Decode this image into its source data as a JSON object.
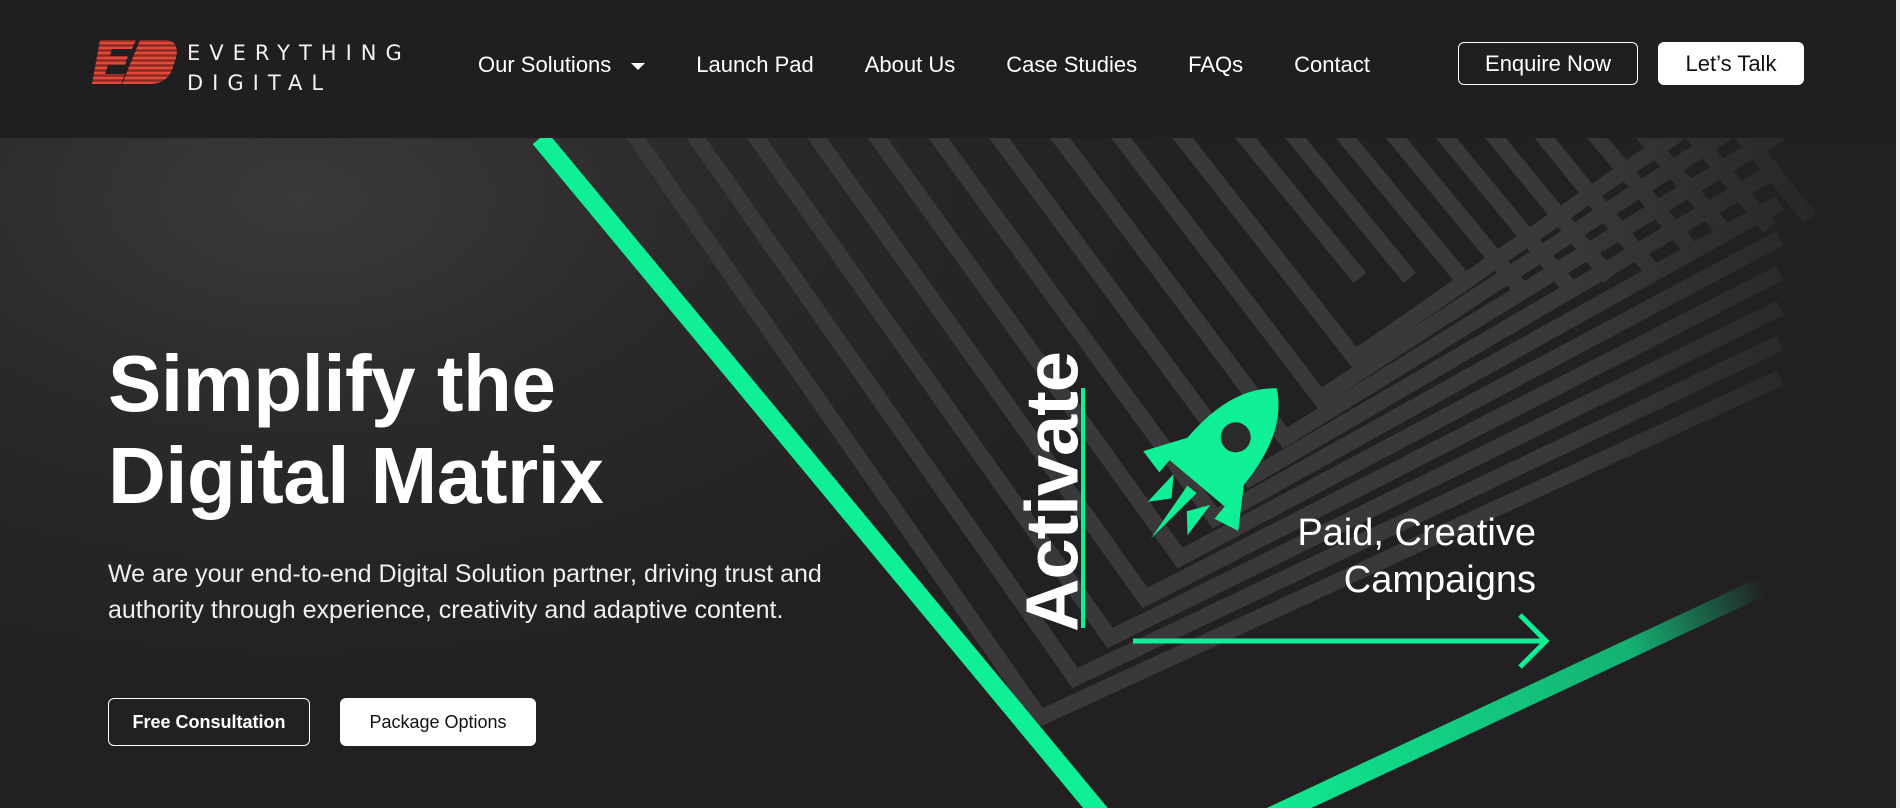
{
  "brand": {
    "line1": "EVERYTHING",
    "line2": "DIGITAL",
    "logo_mark": "ED",
    "logo_color": "#e2493a"
  },
  "nav": {
    "items": [
      {
        "label": "Our Solutions",
        "has_dropdown": true
      },
      {
        "label": "Launch Pad"
      },
      {
        "label": "About Us"
      },
      {
        "label": "Case Studies"
      },
      {
        "label": "FAQs"
      },
      {
        "label": "Contact"
      }
    ],
    "dropdown_icon": "chevron-down-icon"
  },
  "header_actions": {
    "enquire_label": "Enquire Now",
    "talk_label": "Let’s Talk"
  },
  "hero": {
    "title_line1": "Simplify the",
    "title_line2": "Digital Matrix",
    "description": "We are your end-to-end Digital Solution partner, driving trust and authority through experience, creativity and adaptive content.",
    "primary_cta": "Free Consultation",
    "secondary_cta": "Package Options",
    "activate_label": "Activate",
    "campaign_line1": "Paid, Creative",
    "campaign_line2": "Campaigns",
    "rocket_icon": "rocket-icon",
    "arrow_icon": "arrow-right-icon"
  },
  "colors": {
    "accent_green": "#0fef95",
    "background": "#1f1d1f",
    "stripe": "#3b393b",
    "text": "#ffffff"
  }
}
